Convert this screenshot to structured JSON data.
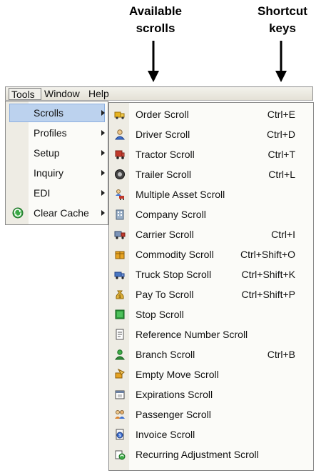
{
  "annotations": {
    "available_line1": "Available",
    "available_line2": "scrolls",
    "shortcut_line1": "Shortcut",
    "shortcut_line2": "keys"
  },
  "menubar": {
    "tools": "Tools",
    "window": "Window",
    "help": "Help"
  },
  "tools_menu": {
    "items": [
      {
        "label": "Scrolls",
        "selected": true,
        "submenu": true
      },
      {
        "label": "Profiles",
        "submenu": true
      },
      {
        "label": "Setup",
        "submenu": true
      },
      {
        "label": "Inquiry",
        "submenu": true
      },
      {
        "label": "EDI",
        "submenu": true
      },
      {
        "label": "Clear Cache",
        "icon": "recycle-icon",
        "submenu": true
      }
    ]
  },
  "scrolls_menu": {
    "items": [
      {
        "label": "Order Scroll",
        "shortcut": "Ctrl+E",
        "icon": "truck-order-icon"
      },
      {
        "label": "Driver Scroll",
        "shortcut": "Ctrl+D",
        "icon": "driver-icon"
      },
      {
        "label": "Tractor Scroll",
        "shortcut": "Ctrl+T",
        "icon": "tractor-icon"
      },
      {
        "label": "Trailer Scroll",
        "shortcut": "Ctrl+L",
        "icon": "trailer-wheel-icon"
      },
      {
        "label": "Multiple Asset Scroll",
        "shortcut": "",
        "icon": "multiple-asset-icon"
      },
      {
        "label": "Company Scroll",
        "shortcut": "",
        "icon": "company-building-icon"
      },
      {
        "label": "Carrier Scroll",
        "shortcut": "Ctrl+I",
        "icon": "carrier-icon"
      },
      {
        "label": "Commodity Scroll",
        "shortcut": "Ctrl+Shift+O",
        "icon": "commodity-box-icon"
      },
      {
        "label": "Truck Stop Scroll",
        "shortcut": "Ctrl+Shift+K",
        "icon": "truck-stop-icon"
      },
      {
        "label": "Pay To Scroll",
        "shortcut": "Ctrl+Shift+P",
        "icon": "money-bag-icon"
      },
      {
        "label": "Stop Scroll",
        "shortcut": "",
        "icon": "stop-icon"
      },
      {
        "label": "Reference Number Scroll",
        "shortcut": "",
        "icon": "reference-document-icon"
      },
      {
        "label": "Branch Scroll",
        "shortcut": "Ctrl+B",
        "icon": "branch-icon"
      },
      {
        "label": "Empty Move Scroll",
        "shortcut": "",
        "icon": "empty-move-icon"
      },
      {
        "label": "Expirations Scroll",
        "shortcut": "",
        "icon": "calendar-icon"
      },
      {
        "label": "Passenger Scroll",
        "shortcut": "",
        "icon": "passenger-icon"
      },
      {
        "label": "Invoice Scroll",
        "shortcut": "",
        "icon": "invoice-icon"
      },
      {
        "label": "Recurring Adjustment Scroll",
        "shortcut": "",
        "icon": "recurring-adjustment-icon"
      }
    ]
  }
}
